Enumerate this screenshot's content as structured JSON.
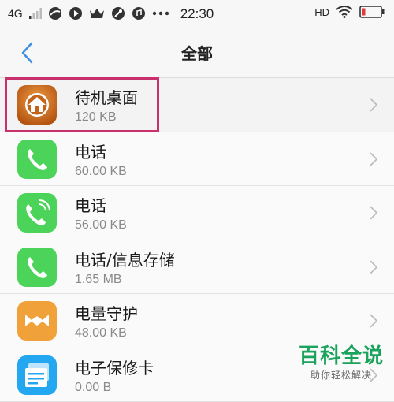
{
  "status_bar": {
    "network": "4G",
    "time": "22:30",
    "hd_label": "HD"
  },
  "nav": {
    "title": "全部"
  },
  "apps": [
    {
      "name": "待机桌面",
      "size": "120 KB",
      "icon": "home-icon"
    },
    {
      "name": "电话",
      "size": "60.00 KB",
      "icon": "phone-icon"
    },
    {
      "name": "电话",
      "size": "56.00 KB",
      "icon": "phone-wifi-icon"
    },
    {
      "name": "电话/信息存储",
      "size": "1.65 MB",
      "icon": "phone-icon"
    },
    {
      "name": "电量守护",
      "size": "48.00 KB",
      "icon": "battery-guard-icon"
    },
    {
      "name": "电子保修卡",
      "size": "0.00 B",
      "icon": "warranty-card-icon"
    }
  ],
  "watermark": {
    "main": "百科全说",
    "sub": "助你轻松解决"
  },
  "colors": {
    "highlight": "#c8316b",
    "back_arrow": "#3d8fe0",
    "phone_green": "#4cd35a",
    "home_orange": "#d9741c",
    "battery_orange": "#f0a13a",
    "card_blue": "#22a7f0",
    "watermark_green": "#1aa35c"
  }
}
